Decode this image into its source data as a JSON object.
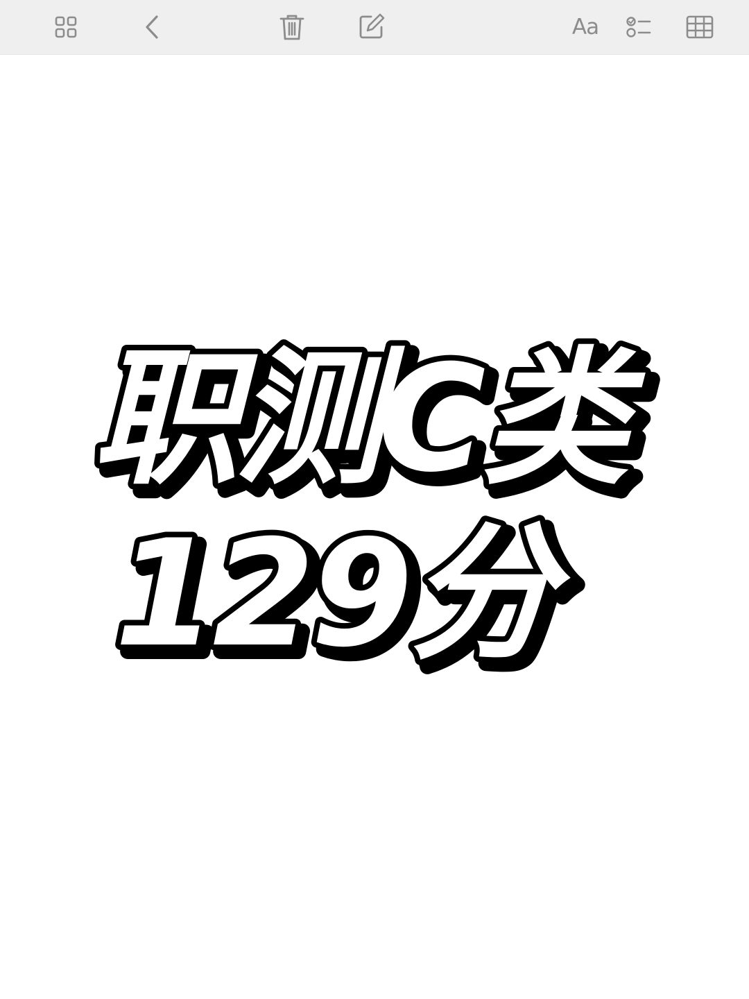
{
  "toolbar": {
    "items": [
      {
        "icon": "gallery-grid-icon"
      },
      {
        "icon": "back-chevron-icon"
      },
      {
        "icon": "trash-icon"
      },
      {
        "icon": "compose-icon"
      },
      {
        "icon": "text-format-icon",
        "label": "Aa"
      },
      {
        "icon": "checklist-icon"
      },
      {
        "icon": "table-icon"
      }
    ],
    "background": "#efefef",
    "icon_color": "#8c8c8c"
  },
  "note": {
    "line1": "职测C类",
    "line2": "129分",
    "text_fill": "#ffffff",
    "outline_color": "#000000"
  }
}
